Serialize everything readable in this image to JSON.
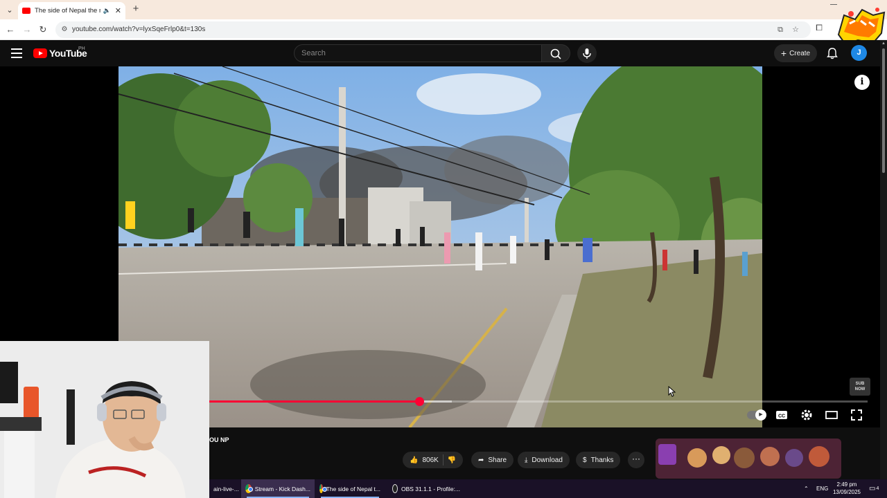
{
  "browser": {
    "tab": {
      "title": "The side of Nepal the media",
      "audio_icon": "speaker-icon",
      "close_icon": "close-icon"
    },
    "new_tab_icon": "plus-icon",
    "nav": {
      "back_icon": "arrow-left-icon",
      "forward_icon": "arrow-right-icon",
      "reload_icon": "reload-icon"
    },
    "url": "youtube.com/watch?v=lyxSqeFrlp0&t=130s",
    "omnibox_icons": [
      "install-app-icon",
      "star-icon"
    ],
    "extensions_icon": "puzzle-icon"
  },
  "youtube": {
    "logo_text": "YouTube",
    "country_code": "PH",
    "search_placeholder": "Search",
    "create_label": "Create",
    "avatar_letter": "J",
    "accent": "#ff0033",
    "channel_fragment": "OU NP",
    "actions": {
      "likes": "806K",
      "share": "Share",
      "download": "Download",
      "thanks": "Thanks"
    },
    "player": {
      "played_fraction": 0.32,
      "buffered_fraction": 0.37,
      "sub_badge": [
        "SUB",
        "NOW"
      ]
    }
  },
  "taskbar": {
    "items": [
      {
        "label": "ain-live-...",
        "icon": "app-icon"
      },
      {
        "label": "Stream - Kick Dash...",
        "icon": "chrome-icon"
      },
      {
        "label": "The side of Nepal t...",
        "icon": "chrome-icon"
      },
      {
        "label": "OBS 31.1.1 - Profile:...",
        "icon": "obs-icon"
      }
    ],
    "language": "ENG",
    "time": "2:49 pm",
    "date": "13/09/2025",
    "notification_count": "4"
  }
}
